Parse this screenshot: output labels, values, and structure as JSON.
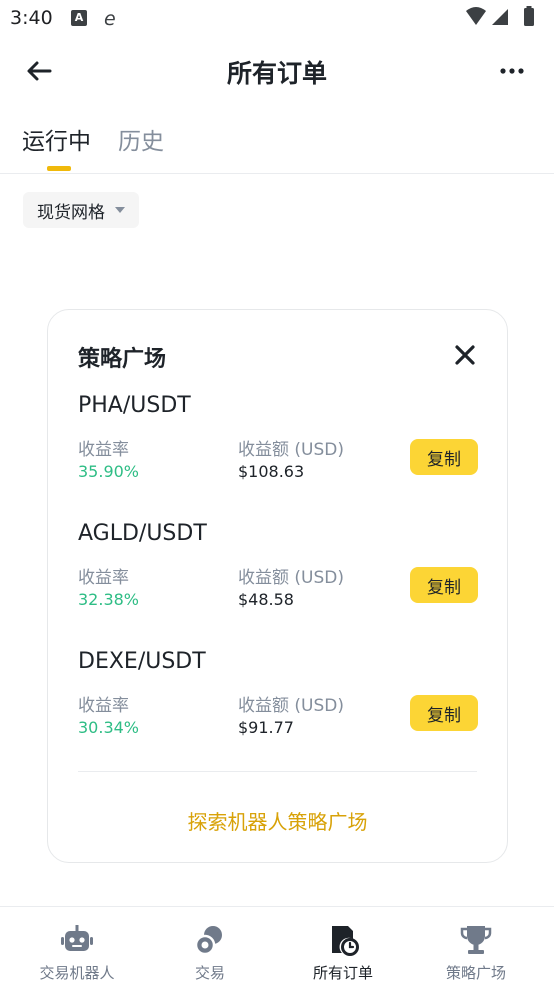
{
  "status_bar": {
    "time": "3:40",
    "notif_a": "A",
    "notif_e": "e"
  },
  "header": {
    "title": "所有订单"
  },
  "tabs": [
    {
      "label": "运行中",
      "active": true
    },
    {
      "label": "历史",
      "active": false
    }
  ],
  "filter": {
    "label": "现货网格"
  },
  "card": {
    "title": "策略广场",
    "rate_label": "收益率",
    "amount_label": "收益额 (USD)",
    "copy_label": "复制",
    "strategies": [
      {
        "pair": "PHA/USDT",
        "rate": "35.90%",
        "amount": "$108.63"
      },
      {
        "pair": "AGLD/USDT",
        "rate": "32.38%",
        "amount": "$48.58"
      },
      {
        "pair": "DEXE/USDT",
        "rate": "30.34%",
        "amount": "$91.77"
      }
    ],
    "explore_label": "探索机器人策略广场"
  },
  "bottom_nav": [
    {
      "label": "交易机器人",
      "icon": "robot-icon",
      "active": false
    },
    {
      "label": "交易",
      "icon": "trade-icon",
      "active": false
    },
    {
      "label": "所有订单",
      "icon": "orders-icon",
      "active": true
    },
    {
      "label": "策略广场",
      "icon": "trophy-icon",
      "active": false
    }
  ],
  "colors": {
    "accent": "#f0b90b",
    "button": "#fcd535",
    "positive": "#2ebd85",
    "link": "#d8a208",
    "muted": "#848e9c"
  }
}
